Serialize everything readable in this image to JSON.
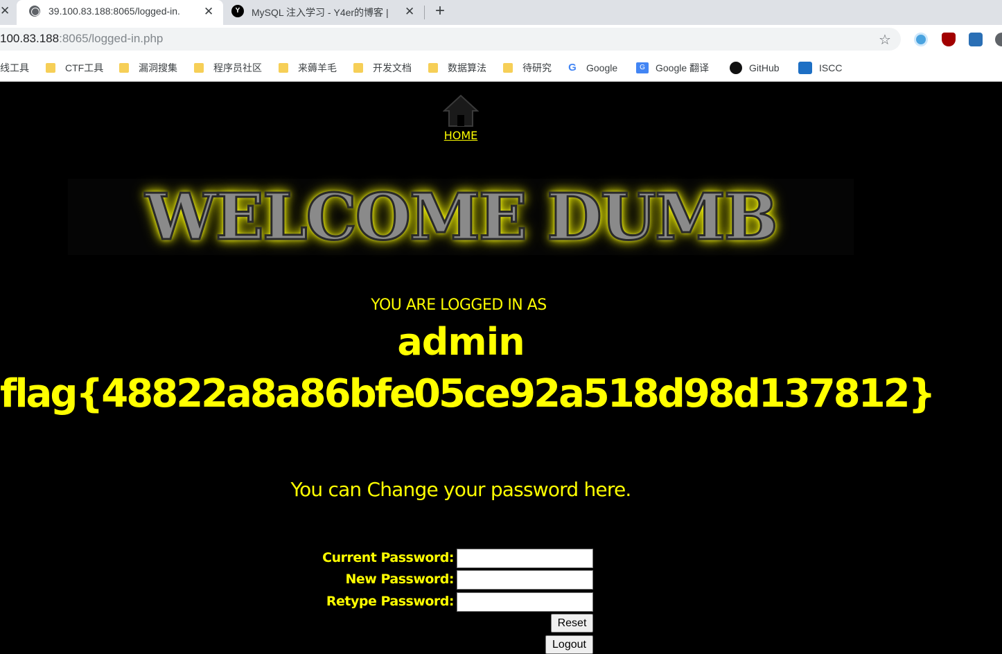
{
  "browser": {
    "tabs": [
      {
        "title": "39.100.83.188:8065/logged-in.",
        "active": true
      },
      {
        "title": "MySQL 注入学习 - Y4er的博客 |",
        "active": false
      }
    ],
    "url": {
      "host": "100.83.188",
      "rest": ":8065/logged-in.php"
    },
    "bookmarks": [
      "线工具",
      "CTF工具",
      "漏洞搜集",
      "程序员社区",
      "来薅羊毛",
      "开发文档",
      "数据算法",
      "待研究",
      "Google",
      "Google 翻译",
      "GitHub",
      "ISCC"
    ]
  },
  "page": {
    "home_label": "HOME",
    "welcome_banner": "WELCOME DUMB",
    "logged_in_label": "YOU ARE LOGGED IN AS",
    "username": "admin",
    "flag": "flag{48822a8a86bfe05ce92a518d98d137812}",
    "change_text": "You can Change your password here.",
    "form": {
      "current_label": "Current Password:",
      "new_label": "New Password:",
      "retype_label": "Retype Password:",
      "reset_button": "Reset",
      "logout_button": "Logout"
    }
  },
  "colors": {
    "accent": "#ffff00",
    "background": "#000000",
    "glow": "#ffff00"
  }
}
